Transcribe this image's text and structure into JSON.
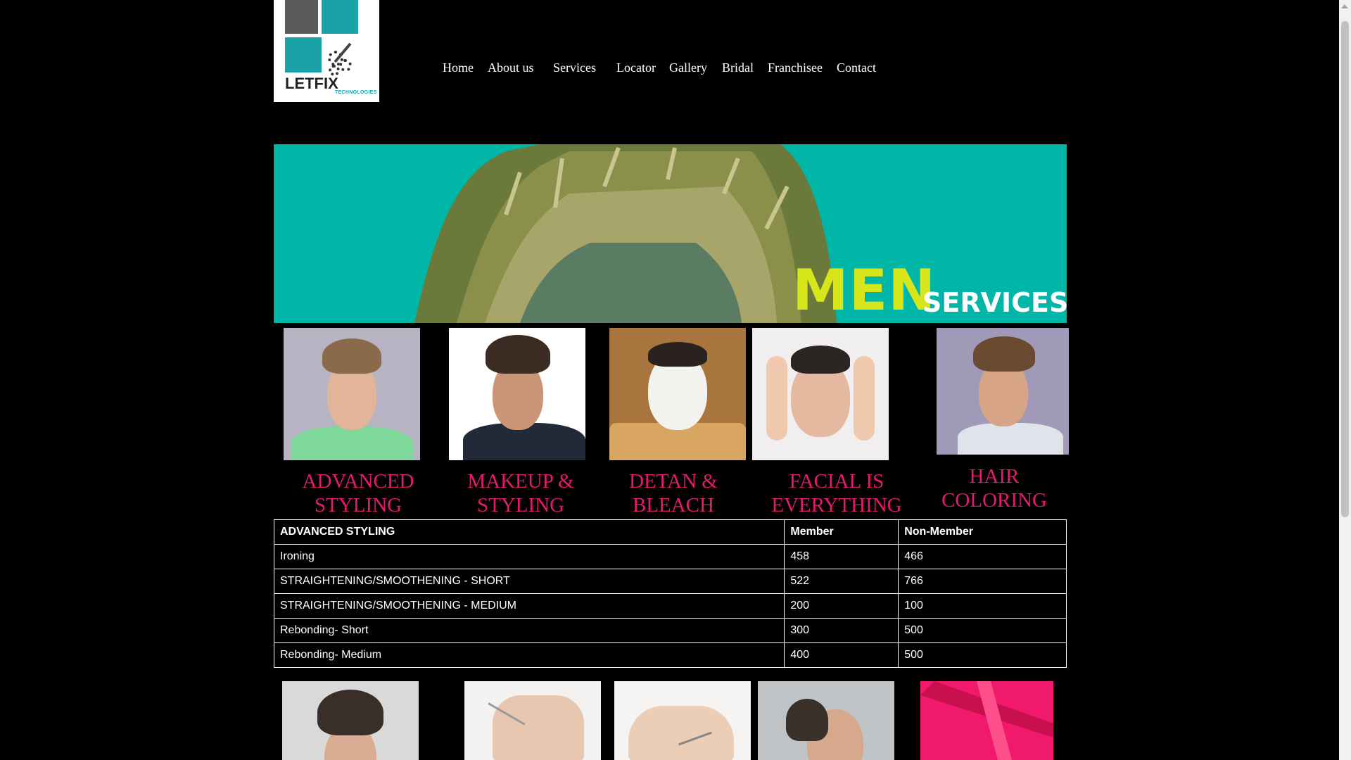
{
  "logo": {
    "wordmark": "LETFIX",
    "tagline": "TECHNOLOGIES"
  },
  "nav": [
    {
      "label": "Home"
    },
    {
      "label": "About us"
    },
    {
      "label": "Services"
    },
    {
      "label": "Locator"
    },
    {
      "label": "Gallery"
    },
    {
      "label": "Bridal"
    },
    {
      "label": "Franchisee"
    },
    {
      "label": "Contact"
    }
  ],
  "banner": {
    "headline": "MEN",
    "subheadline": "SERVICES"
  },
  "services": [
    {
      "caption_line1": "ADVANCED",
      "caption_line2": "STYLING"
    },
    {
      "caption_line1": "MAKEUP &",
      "caption_line2": "STYLING"
    },
    {
      "caption_line1": "DETAN &",
      "caption_line2": "BLEACH"
    },
    {
      "caption_line1": "FACIAL IS",
      "caption_line2": "EVERYTHING"
    },
    {
      "caption_line1": "HAIR",
      "caption_line2": "COLORING"
    }
  ],
  "price_table": {
    "headers": [
      "ADVANCED STYLING",
      "Member",
      "Non-Member"
    ],
    "rows": [
      [
        "Ironing",
        "458",
        "466"
      ],
      [
        "STRAIGHTENING/SMOOTHENING - SHORT",
        "522",
        "766"
      ],
      [
        "STRAIGHTENING/SMOOTHENING - MEDIUM",
        "200",
        "100"
      ],
      [
        "Rebonding- Short",
        "300",
        "500"
      ],
      [
        "Rebonding- Medium",
        "400",
        "500"
      ]
    ]
  },
  "colors": {
    "background": "#000000",
    "accent_pink": "#e31b6d",
    "banner_teal": "#00b6a7",
    "banner_yellow": "#d6e61b"
  }
}
